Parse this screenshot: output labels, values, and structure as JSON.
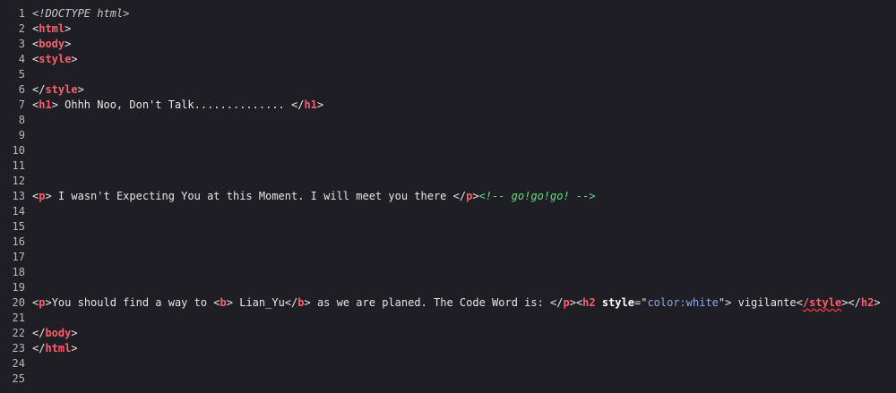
{
  "editor": {
    "language": "html",
    "colors": {
      "background": "#1f1e24",
      "line_number": "#b8b8b8",
      "text": "#e6e6e6",
      "tag": "#ff5f6d",
      "comment": "#5ee07a",
      "string": "#8fa8e8",
      "doctype": "#c8c8c8"
    },
    "lines": [
      {
        "num": "1",
        "tokens": [
          {
            "t": "doctype",
            "v": "<!DOCTYPE html>"
          }
        ]
      },
      {
        "num": "2",
        "tokens": [
          {
            "t": "plain",
            "v": "<"
          },
          {
            "t": "tag",
            "v": "html"
          },
          {
            "t": "plain",
            "v": ">"
          }
        ]
      },
      {
        "num": "3",
        "tokens": [
          {
            "t": "plain",
            "v": "<"
          },
          {
            "t": "tag",
            "v": "body"
          },
          {
            "t": "plain",
            "v": ">"
          }
        ]
      },
      {
        "num": "4",
        "tokens": [
          {
            "t": "plain",
            "v": "<"
          },
          {
            "t": "tag",
            "v": "style"
          },
          {
            "t": "plain",
            "v": ">"
          }
        ]
      },
      {
        "num": "5",
        "tokens": []
      },
      {
        "num": "6",
        "tokens": [
          {
            "t": "plain",
            "v": "</"
          },
          {
            "t": "tag",
            "v": "style"
          },
          {
            "t": "plain",
            "v": ">"
          }
        ]
      },
      {
        "num": "7",
        "tokens": [
          {
            "t": "plain",
            "v": "<"
          },
          {
            "t": "tag",
            "v": "h1"
          },
          {
            "t": "plain",
            "v": "> Ohhh Noo, Don't Talk.............. </"
          },
          {
            "t": "tag",
            "v": "h1"
          },
          {
            "t": "plain",
            "v": ">"
          }
        ]
      },
      {
        "num": "8",
        "tokens": []
      },
      {
        "num": "9",
        "tokens": []
      },
      {
        "num": "10",
        "tokens": []
      },
      {
        "num": "11",
        "tokens": []
      },
      {
        "num": "12",
        "tokens": []
      },
      {
        "num": "13",
        "tokens": [
          {
            "t": "plain",
            "v": "<"
          },
          {
            "t": "tag",
            "v": "p"
          },
          {
            "t": "plain",
            "v": "> I wasn't Expecting You at this Moment. I will meet you there </"
          },
          {
            "t": "tag",
            "v": "p"
          },
          {
            "t": "plain",
            "v": ">"
          },
          {
            "t": "comment",
            "v": "<!-- go!go!go! -->"
          }
        ]
      },
      {
        "num": "14",
        "tokens": []
      },
      {
        "num": "15",
        "tokens": []
      },
      {
        "num": "16",
        "tokens": []
      },
      {
        "num": "17",
        "tokens": []
      },
      {
        "num": "18",
        "tokens": []
      },
      {
        "num": "19",
        "tokens": []
      },
      {
        "num": "20",
        "tokens": [
          {
            "t": "plain",
            "v": "<"
          },
          {
            "t": "tag",
            "v": "p"
          },
          {
            "t": "plain",
            "v": ">You should find a way to <"
          },
          {
            "t": "tag",
            "v": "b"
          },
          {
            "t": "plain",
            "v": "> Lian_Yu</"
          },
          {
            "t": "tag",
            "v": "b"
          },
          {
            "t": "plain",
            "v": "> as we are planed. The Code Word is: </"
          },
          {
            "t": "tag",
            "v": "p"
          },
          {
            "t": "plain",
            "v": "><"
          },
          {
            "t": "tag",
            "v": "h2"
          },
          {
            "t": "plain",
            "v": " "
          },
          {
            "t": "attr",
            "v": "style"
          },
          {
            "t": "plain",
            "v": "=\""
          },
          {
            "t": "string",
            "v": "color:white"
          },
          {
            "t": "plain",
            "v": "\"> vigilante<"
          },
          {
            "t": "error",
            "v": "/style"
          },
          {
            "t": "plain",
            "v": "></"
          },
          {
            "t": "tag",
            "v": "h2"
          },
          {
            "t": "plain",
            "v": ">"
          }
        ]
      },
      {
        "num": "21",
        "tokens": []
      },
      {
        "num": "22",
        "tokens": [
          {
            "t": "plain",
            "v": "</"
          },
          {
            "t": "tag",
            "v": "body"
          },
          {
            "t": "plain",
            "v": ">"
          }
        ]
      },
      {
        "num": "23",
        "tokens": [
          {
            "t": "plain",
            "v": "</"
          },
          {
            "t": "tag",
            "v": "html"
          },
          {
            "t": "plain",
            "v": ">"
          }
        ]
      },
      {
        "num": "24",
        "tokens": []
      },
      {
        "num": "25",
        "tokens": []
      }
    ]
  }
}
